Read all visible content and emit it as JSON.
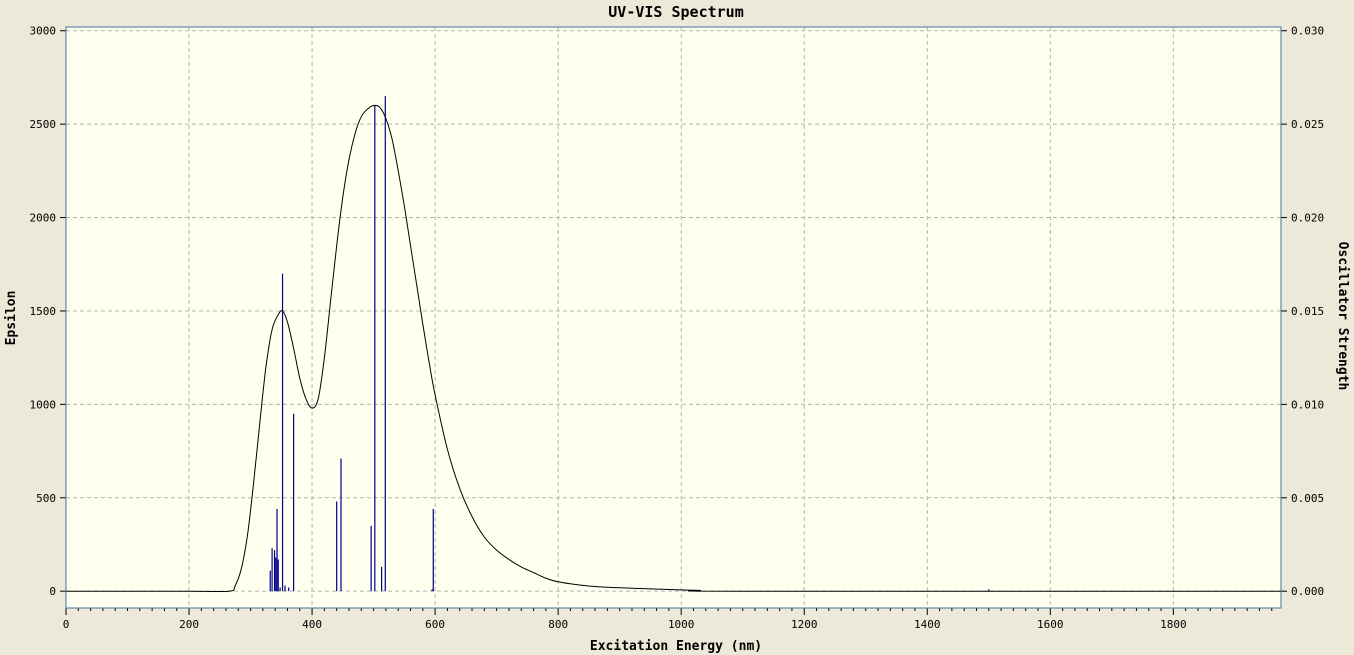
{
  "chart_data": {
    "type": "line",
    "title": "UV-VIS Spectrum",
    "xlabel": "Excitation Energy (nm)",
    "ylabel": "Epsilon",
    "y2label": "Oscillator Strength",
    "xlim": [
      0,
      1975
    ],
    "ylim": [
      -90,
      3020
    ],
    "y2lim": [
      -0.0009,
      0.0302
    ],
    "x_ticks": [
      0,
      200,
      400,
      600,
      800,
      1000,
      1200,
      1400,
      1600,
      1800
    ],
    "x_tick_labels": [
      "0",
      "200",
      "400",
      "600",
      "800",
      "1000",
      "1200",
      "1400",
      "1600",
      "1800"
    ],
    "y_ticks": [
      0,
      500,
      1000,
      1500,
      2000,
      2500,
      3000
    ],
    "y_tick_labels": [
      "0",
      "500",
      "1000",
      "1500",
      "2000",
      "2500",
      "3000"
    ],
    "y2_ticks": [
      0,
      0.005,
      0.01,
      0.015,
      0.02,
      0.025,
      0.03
    ],
    "y2_tick_labels": [
      "0.000",
      "0.005",
      "0.010",
      "0.015",
      "0.020",
      "0.025",
      "0.030"
    ],
    "grid": true,
    "colors": {
      "background": "#ece9d8",
      "plot_background": "#fffff0",
      "frame": "#4a6fa5",
      "grid": "#b4b4b4",
      "epsilon_curve": "#000000",
      "oscillator_lines": "#00008b"
    },
    "series": [
      {
        "axis": "left",
        "x": [
          0,
          200,
          265,
          275,
          285,
          295,
          305,
          315,
          325,
          335,
          345,
          352,
          360,
          370,
          380,
          390,
          400,
          410,
          420,
          430,
          440,
          450,
          460,
          470,
          480,
          490,
          500,
          510,
          520,
          530,
          540,
          550,
          560,
          570,
          580,
          590,
          600,
          620,
          640,
          660,
          680,
          700,
          720,
          740,
          760,
          780,
          800,
          830,
          860,
          900,
          950,
          1000,
          1030,
          1100,
          1975
        ],
        "y": [
          0,
          0,
          0,
          30,
          120,
          300,
          580,
          900,
          1200,
          1400,
          1480,
          1500,
          1440,
          1300,
          1140,
          1030,
          980,
          1030,
          1250,
          1550,
          1850,
          2110,
          2310,
          2450,
          2540,
          2580,
          2600,
          2590,
          2530,
          2420,
          2250,
          2060,
          1850,
          1640,
          1430,
          1230,
          1050,
          760,
          550,
          400,
          290,
          220,
          170,
          130,
          100,
          70,
          50,
          35,
          25,
          18,
          12,
          7,
          4,
          0,
          0
        ]
      },
      {
        "axis": "right",
        "type": "stem",
        "x": [
          332,
          335,
          339,
          341,
          343,
          345,
          348,
          352,
          356,
          362,
          370,
          440,
          447,
          496,
          502,
          513,
          519,
          595,
          597,
          1500
        ],
        "y": [
          0.0011,
          0.0023,
          0.0022,
          0.0018,
          0.0044,
          0.0017,
          0.0002,
          0.017,
          0.0003,
          0.0002,
          0.0095,
          0.0048,
          0.0071,
          0.0035,
          0.026,
          0.0013,
          0.0265,
          0.0001,
          0.0044,
          0.0001
        ]
      }
    ]
  }
}
